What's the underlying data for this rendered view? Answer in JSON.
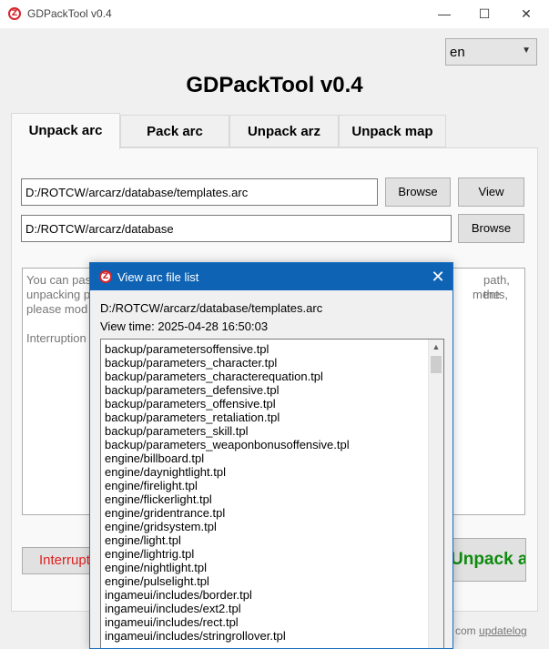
{
  "window": {
    "icon_glyph": "Z",
    "title": "GDPackTool v0.4",
    "minimize_icon": "minimize-icon",
    "maximize_icon": "maximize-icon",
    "close_icon": "close-icon"
  },
  "language": {
    "selected": "en"
  },
  "app_heading": "GDPackTool v0.4",
  "tabs": [
    {
      "label": "Unpack arc",
      "active": true
    },
    {
      "label": "Pack arc",
      "active": false
    },
    {
      "label": "Unpack arz",
      "active": false
    },
    {
      "label": "Unpack map",
      "active": false
    }
  ],
  "unpack_arc": {
    "source_path": "D:/ROTCW/arcarz/database/templates.arc",
    "browse_source_label": "Browse",
    "view_label": "View",
    "output_path": "D:/ROTCW/arcarz/database",
    "browse_output_label": "Browse",
    "description_lines": {
      "l1": "You can pas",
      "l2": "unpacking p",
      "l3": "please mod",
      "l4": "Interruption",
      "r1": "path, the",
      "r2": "ments,"
    },
    "interrupt_label": "Interrupt",
    "unpack_button_label": "Unpack arc"
  },
  "footer": {
    "prefix": "com",
    "link_label": "updatelog"
  },
  "dialog": {
    "title": "View arc file list",
    "path": "D:/ROTCW/arcarz/database/templates.arc",
    "view_time": "View time: 2025-04-28 16:50:03",
    "files": [
      "backup/parametersoffensive.tpl",
      "backup/parameters_character.tpl",
      "backup/parameters_characterequation.tpl",
      "backup/parameters_defensive.tpl",
      "backup/parameters_offensive.tpl",
      "backup/parameters_retaliation.tpl",
      "backup/parameters_skill.tpl",
      "backup/parameters_weaponbonusoffensive.tpl",
      "engine/billboard.tpl",
      "engine/daynightlight.tpl",
      "engine/firelight.tpl",
      "engine/flickerlight.tpl",
      "engine/gridentrance.tpl",
      "engine/gridsystem.tpl",
      "engine/light.tpl",
      "engine/lightrig.tpl",
      "engine/nightlight.tpl",
      "engine/pulselight.tpl",
      "ingameui/includes/border.tpl",
      "ingameui/includes/ext2.tpl",
      "ingameui/includes/rect.tpl",
      "ingameui/includes/stringrollover.tpl"
    ]
  }
}
